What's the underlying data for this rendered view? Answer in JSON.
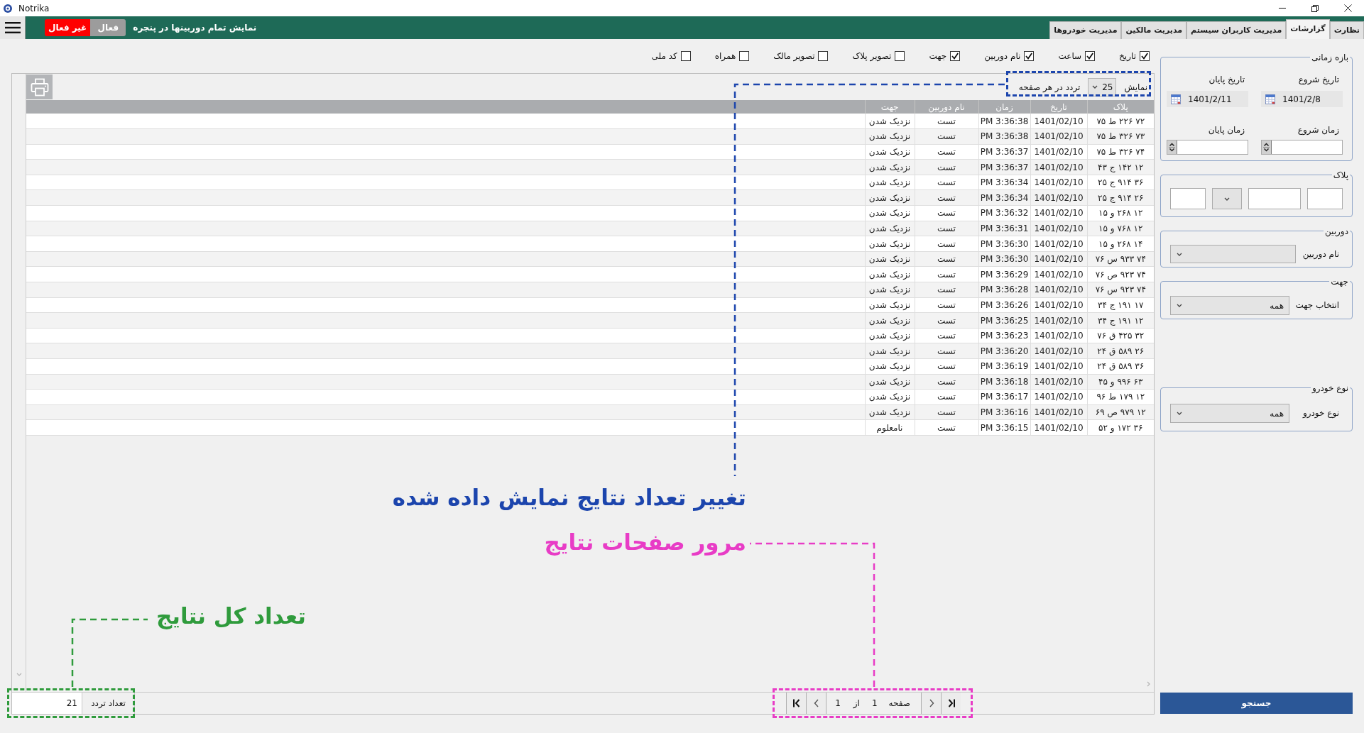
{
  "window": {
    "title": "Notrika"
  },
  "top_bar": {
    "tabs": [
      {
        "label": "نظارت",
        "selected": false
      },
      {
        "label": "گزارشات",
        "selected": true
      },
      {
        "label": "مدیریت کاربران سیستم",
        "selected": false
      },
      {
        "label": "مدیریت مالکین",
        "selected": false
      },
      {
        "label": "مدیریت خودروها",
        "selected": false
      }
    ],
    "camera_toggle": {
      "caption": "نمایش تمام دوربینها در پنجره",
      "options": [
        {
          "label": "فعال",
          "selected": false
        },
        {
          "label": "غیر فعال",
          "selected": true
        }
      ]
    }
  },
  "filters": {
    "time_range": {
      "title": "بازه زمانی",
      "start_date": {
        "label": "تاریخ شروع",
        "value": "1401/2/8"
      },
      "end_date": {
        "label": "تاریخ پایان",
        "value": "1401/2/11"
      },
      "start_time": {
        "label": "زمان شروع"
      },
      "end_time": {
        "label": "زمان پایان"
      }
    },
    "plate": {
      "title": "پلاک"
    },
    "camera": {
      "title": "دوربین",
      "label": "نام دوربین"
    },
    "direction": {
      "title": "جهت",
      "label": "انتخاب جهت",
      "value": "همه"
    },
    "vehicle_type": {
      "title": "نوع خودرو",
      "label": "نوع خودرو",
      "value": "همه"
    },
    "search_button": "جستجو"
  },
  "column_options": [
    {
      "label": "تاریخ",
      "checked": true
    },
    {
      "label": "ساعت",
      "checked": true
    },
    {
      "label": "نام دوربین",
      "checked": true
    },
    {
      "label": "جهت",
      "checked": true
    },
    {
      "label": "تصویر پلاک",
      "checked": false
    },
    {
      "label": "تصویر مالک",
      "checked": false
    },
    {
      "label": "همراه",
      "checked": false
    },
    {
      "label": "کد ملی",
      "checked": false
    }
  ],
  "page_size": {
    "label": "نمایش",
    "value": "25",
    "suffix": "تردد در هر صفحه"
  },
  "table": {
    "columns": [
      "پلاک",
      "تاریخ",
      "زمان",
      "نام دوربین",
      "جهت"
    ],
    "rows": [
      [
        "۷۲ ۲۲۶ ط ۷۵",
        "1401/02/10",
        "PM 3:36:38",
        "تست",
        "نزدیک شدن"
      ],
      [
        "۷۳ ۳۲۶ ط ۷۵",
        "1401/02/10",
        "PM 3:36:38",
        "تست",
        "نزدیک شدن"
      ],
      [
        "۷۴ ۳۲۶ ط ۷۵",
        "1401/02/10",
        "PM 3:36:37",
        "تست",
        "نزدیک شدن"
      ],
      [
        "۱۲ ۱۴۲ ج ۴۳",
        "1401/02/10",
        "PM 3:36:37",
        "تست",
        "نزدیک شدن"
      ],
      [
        "۳۶ ۹۱۴ ج ۲۵",
        "1401/02/10",
        "PM 3:36:34",
        "تست",
        "نزدیک شدن"
      ],
      [
        "۲۶ ۹۱۴ ج ۲۵",
        "1401/02/10",
        "PM 3:36:34",
        "تست",
        "نزدیک شدن"
      ],
      [
        "۱۲ ۲۶۸ و ۱۵",
        "1401/02/10",
        "PM 3:36:32",
        "تست",
        "نزدیک شدن"
      ],
      [
        "۱۲ ۷۶۸ و ۱۵",
        "1401/02/10",
        "PM 3:36:31",
        "تست",
        "نزدیک شدن"
      ],
      [
        "۱۴ ۲۶۸ و ۱۵",
        "1401/02/10",
        "PM 3:36:30",
        "تست",
        "نزدیک شدن"
      ],
      [
        "۷۴ ۹۳۳ س ۷۶",
        "1401/02/10",
        "PM 3:36:30",
        "تست",
        "نزدیک شدن"
      ],
      [
        "۷۴ ۹۲۳ ص ۷۶",
        "1401/02/10",
        "PM 3:36:29",
        "تست",
        "نزدیک شدن"
      ],
      [
        "۷۴ ۹۲۳ س ۷۶",
        "1401/02/10",
        "PM 3:36:28",
        "تست",
        "نزدیک شدن"
      ],
      [
        "۱۷ ۱۹۱ ج ۳۴",
        "1401/02/10",
        "PM 3:36:26",
        "تست",
        "نزدیک شدن"
      ],
      [
        "۱۲ ۱۹۱ ج ۳۴",
        "1401/02/10",
        "PM 3:36:25",
        "تست",
        "نزدیک شدن"
      ],
      [
        "۳۲ ۴۲۵ ق ۷۶",
        "1401/02/10",
        "PM 3:36:23",
        "تست",
        "نزدیک شدن"
      ],
      [
        "۲۶ ۵۸۹ ق ۲۴",
        "1401/02/10",
        "PM 3:36:20",
        "تست",
        "نزدیک شدن"
      ],
      [
        "۳۶ ۵۸۹ ق ۲۴",
        "1401/02/10",
        "PM 3:36:19",
        "تست",
        "نزدیک شدن"
      ],
      [
        "۶۳ ۹۹۶ و ۴۵",
        "1401/02/10",
        "PM 3:36:18",
        "تست",
        "نزدیک شدن"
      ],
      [
        "۱۲ ۱۷۹ ط ۹۶",
        "1401/02/10",
        "PM 3:36:17",
        "تست",
        "نزدیک شدن"
      ],
      [
        "۱۲ ۹۷۹ ص ۶۹",
        "1401/02/10",
        "PM 3:36:16",
        "تست",
        "نزدیک شدن"
      ],
      [
        "۳۶ ۱۷۲ و ۵۲",
        "1401/02/10",
        "PM 3:36:15",
        "تست",
        "نامعلوم"
      ]
    ]
  },
  "footer": {
    "pagination": {
      "page_label": "صفحه",
      "page": "1",
      "of_label": "از",
      "total": "1"
    },
    "count_label": "تعداد تردد",
    "count": "21"
  },
  "callouts": [
    {
      "text": "تغییر تعداد نتایج نمایش داده شده",
      "color": "#1c45ad"
    },
    {
      "text": "مرور صفحات نتایج",
      "color": "#e83cc6"
    },
    {
      "text": "تعداد کل نتایج",
      "color": "#2f9b3c"
    }
  ]
}
